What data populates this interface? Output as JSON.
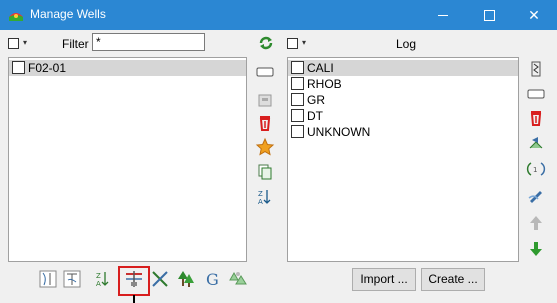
{
  "window": {
    "title": "Manage Wells",
    "controls": {
      "minimize": "—",
      "maximize": "☐",
      "close": "✕"
    }
  },
  "left": {
    "filter_label": "Filter",
    "filter_value": "*",
    "wells": [
      {
        "name": "F02-01",
        "checked": false,
        "selected": true
      }
    ]
  },
  "right": {
    "header": "Log",
    "logs": [
      {
        "name": "CALI",
        "checked": false,
        "selected": true
      },
      {
        "name": "RHOB",
        "checked": false
      },
      {
        "name": "GR",
        "checked": false
      },
      {
        "name": "DT",
        "checked": false
      },
      {
        "name": "UNKNOWN",
        "checked": false
      }
    ]
  },
  "buttons": {
    "import": "Import ...",
    "create": "Create ..."
  },
  "icons": {
    "app": "wells-app-icon",
    "refresh": "refresh-icon",
    "middle_toolbar": [
      "rename-icon",
      "properties-icon",
      "delete-icon",
      "favorite-star-icon",
      "copy-icon",
      "sort-icon"
    ],
    "right_toolbar": [
      "log-properties-icon",
      "rename-icon",
      "delete-icon",
      "export-icon",
      "merge-icon",
      "edit-icon",
      "move-up-icon",
      "move-down-icon"
    ],
    "bottom_toolbar": [
      "track-icon",
      "markers-icon",
      "sort-wells-icon",
      "well-tie-icon",
      "cross-plot-icon",
      "tree-icon",
      "g-icon",
      "stratigraphy-icon"
    ]
  },
  "colors": {
    "titlebar": "#2b87d3",
    "selection": "#d6d6d6",
    "highlight": "#d81e1e",
    "delete_red": "#d81e1e",
    "star_orange": "#f0a020",
    "green_arrow": "#2e9a2e"
  }
}
